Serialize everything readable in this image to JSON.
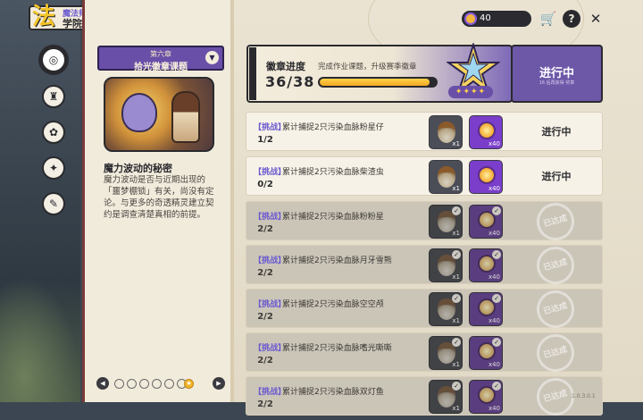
{
  "header": {
    "logo_glyph": "法",
    "subtitle": "魔法师手册",
    "title": "学院作业"
  },
  "sidebar": {
    "items": [
      {
        "name": "compass",
        "glyph": "◎",
        "active": true
      },
      {
        "name": "crest",
        "glyph": "♜",
        "active": false
      },
      {
        "name": "flower",
        "glyph": "✿",
        "active": false
      },
      {
        "name": "sparkle",
        "glyph": "✦",
        "active": false
      },
      {
        "name": "pen",
        "glyph": "✎",
        "active": false
      }
    ]
  },
  "chapter": {
    "number": "第六章",
    "title": "拾光徽章课题",
    "toggle_glyph": "▼",
    "story_title": "魔力波动的秘密",
    "story_text": "魔力波动是否与近期出现的「噩梦棚锁」有关，尚没有定论。与更多的奇透精灵建立契约是调查清楚真相的前提。"
  },
  "pager": {
    "prev_glyph": "◀",
    "next_glyph": "▶",
    "pages": 6,
    "current_star": "★"
  },
  "topbar": {
    "coins": "40",
    "shop_glyph": "🛒",
    "help_glyph": "?",
    "close_glyph": "✕"
  },
  "badge": {
    "title": "徽章进度",
    "desc": "完成作业课题，升级赛季徽章",
    "count": "36/38",
    "progress": 0.947,
    "stars": "✦✦✦✦",
    "status": "进行中",
    "status_sub": "16 后再获得 奖章"
  },
  "tasks": {
    "tag": "【挑战】",
    "rows": [
      {
        "text": "累计捕捉2只污染血脉粉星仔",
        "progress": "1/2",
        "state": "进行中",
        "done": false,
        "qty1": "x1",
        "qty2": "x40"
      },
      {
        "text": "累计捕捉2只污染血脉柴渣虫",
        "progress": "0/2",
        "state": "进行中",
        "done": false,
        "qty1": "x1",
        "qty2": "x40"
      },
      {
        "text": "累计捕捉2只污染血脉粉粉星",
        "progress": "2/2",
        "state": "已达成",
        "done": true,
        "qty1": "x1",
        "qty2": "x40"
      },
      {
        "text": "累计捕捉2只污染血脉月牙雪熊",
        "progress": "2/2",
        "state": "已达成",
        "done": true,
        "qty1": "x1",
        "qty2": "x40"
      },
      {
        "text": "累计捕捉2只污染血脉空空颅",
        "progress": "2/2",
        "state": "已达成",
        "done": true,
        "qty1": "x1",
        "qty2": "x40"
      },
      {
        "text": "累计捕捉2只污染血脉嗜光嘶嘶",
        "progress": "2/2",
        "state": "已达成",
        "done": true,
        "qty1": "x1",
        "qty2": "x40"
      },
      {
        "text": "累计捕捉2只污染血脉双灯鱼",
        "progress": "2/2",
        "state": "已达成",
        "done": true,
        "qty1": "x1",
        "qty2": "x40"
      }
    ]
  },
  "footer": {
    "version": "1.0.3.0.1"
  }
}
